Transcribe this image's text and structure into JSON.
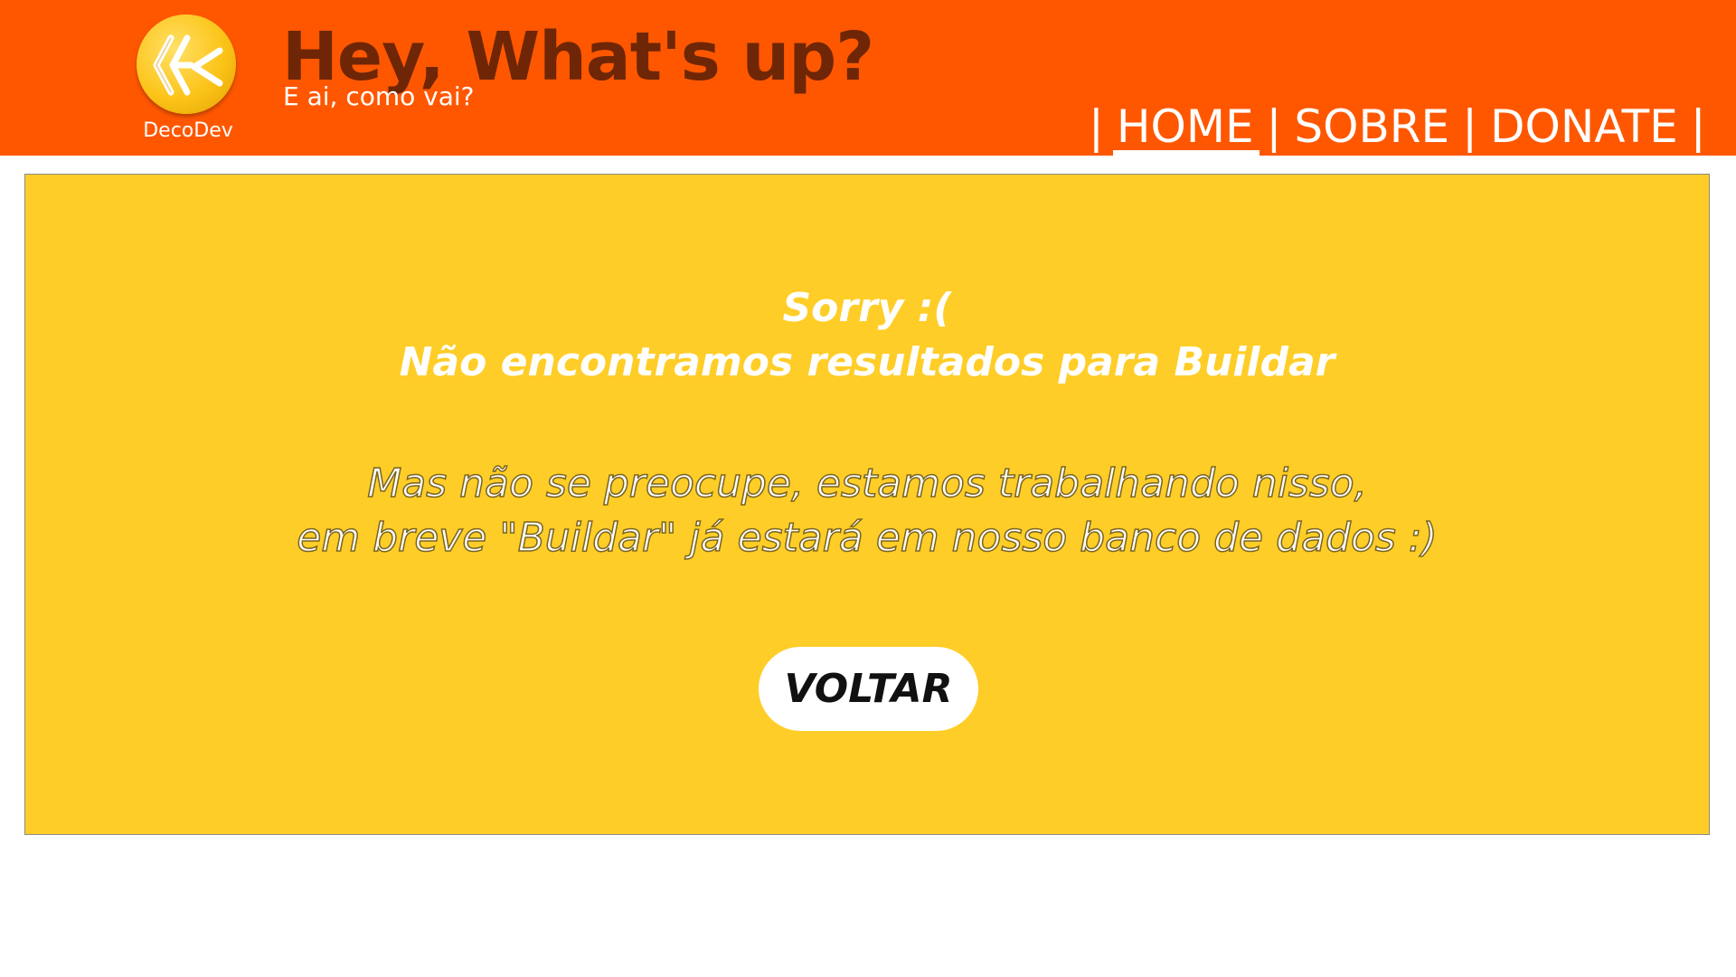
{
  "header": {
    "logo_name": "DecoDev",
    "title": "Hey, What's up?",
    "subtitle": "E ai, como vai?"
  },
  "nav": {
    "separator": "|",
    "items": [
      {
        "label": "HOME",
        "active": true
      },
      {
        "label": "SOBRE",
        "active": false
      },
      {
        "label": "DONATE",
        "active": false
      }
    ]
  },
  "message": {
    "line1": "Sorry :(",
    "line2": "Não encontramos resultados para Buildar",
    "line3": "Mas não se preocupe, estamos trabalhando nisso,",
    "line4": "em breve \"Buildar\" já estará em nosso banco de dados :)"
  },
  "button": {
    "label": "VOLTAR"
  },
  "colors": {
    "header_bg": "#ff5700",
    "title_color": "#6e2606",
    "panel_bg": "#ffcd27",
    "logo_bg": "#fcc419",
    "text_white": "#ffffff"
  },
  "icons": {
    "logo": "decodev-logo-icon"
  }
}
